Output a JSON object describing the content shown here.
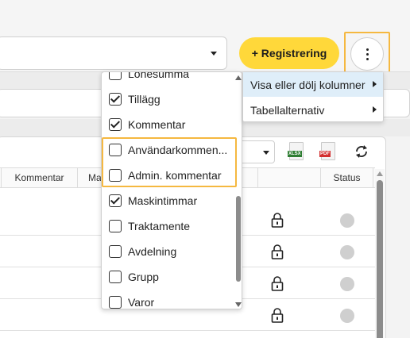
{
  "header": {
    "register_button": "+ Registrering"
  },
  "table": {
    "columns": [
      "Kommentar",
      "Ma",
      "",
      "Status"
    ],
    "rows": [
      {
        "locked": true,
        "status_color": "#cfcfcf"
      },
      {
        "locked": true,
        "status_color": "#cfcfcf"
      },
      {
        "locked": true,
        "status_color": "#cfcfcf"
      },
      {
        "locked": true,
        "status_color": "#cfcfcf"
      }
    ],
    "export_icons": [
      "XLSX",
      "PDF"
    ]
  },
  "column_menu": {
    "items": [
      {
        "label": "Lönesumma",
        "checked": false
      },
      {
        "label": "Tillägg",
        "checked": true
      },
      {
        "label": "Kommentar",
        "checked": true
      },
      {
        "label": "Användarkommen...",
        "checked": false
      },
      {
        "label": "Admin. kommentar",
        "checked": false
      },
      {
        "label": "Maskintimmar",
        "checked": true
      },
      {
        "label": "Traktamente",
        "checked": false
      },
      {
        "label": "Avdelning",
        "checked": false
      },
      {
        "label": "Grupp",
        "checked": false
      },
      {
        "label": "Varor",
        "checked": false
      }
    ]
  },
  "context_menu": {
    "items": [
      {
        "label": "Visa eller dölj kolumner",
        "active": true
      },
      {
        "label": "Tabellalternativ",
        "active": false
      }
    ]
  },
  "colors": {
    "accent": "#ffd83a",
    "highlight": "#f5b840",
    "active_menu": "#dfeef9"
  }
}
